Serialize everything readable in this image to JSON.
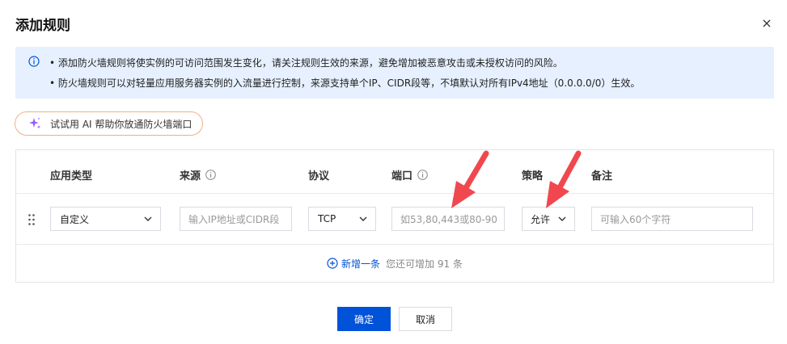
{
  "dialog": {
    "title": "添加规则",
    "close_glyph": "×"
  },
  "notice": {
    "icon": "info-circle-icon",
    "line1": "• 添加防火墙规则将使实例的可访问范围发生变化，请关注规则生效的来源，避免增加被恶意攻击或未授权访问的风险。",
    "line2": "• 防火墙规则可以对轻量应用服务器实例的入流量进行控制，来源支持单个IP、CIDR段等，不填默认对所有IPv4地址（0.0.0.0/0）生效。"
  },
  "ai_button": {
    "label": "试试用 AI 帮助你放通防火墙端口"
  },
  "table": {
    "headers": {
      "app_type": "应用类型",
      "source": "来源",
      "protocol": "协议",
      "port": "端口",
      "policy": "策略",
      "remark": "备注"
    },
    "row": {
      "app_type": "自定义",
      "source_placeholder": "输入IP地址或CIDR段",
      "protocol": "TCP",
      "port_placeholder": "如53,80,443或80-90",
      "policy": "允许",
      "remark_placeholder": "可输入60个字符"
    },
    "add": {
      "label": "新增一条",
      "remaining": "您还可增加 91 条"
    }
  },
  "footer": {
    "confirm": "确定",
    "cancel": "取消"
  },
  "colors": {
    "primary": "#0052d9",
    "notice_bg": "#e6f0ff",
    "annotation_arrow": "#f0484e"
  }
}
